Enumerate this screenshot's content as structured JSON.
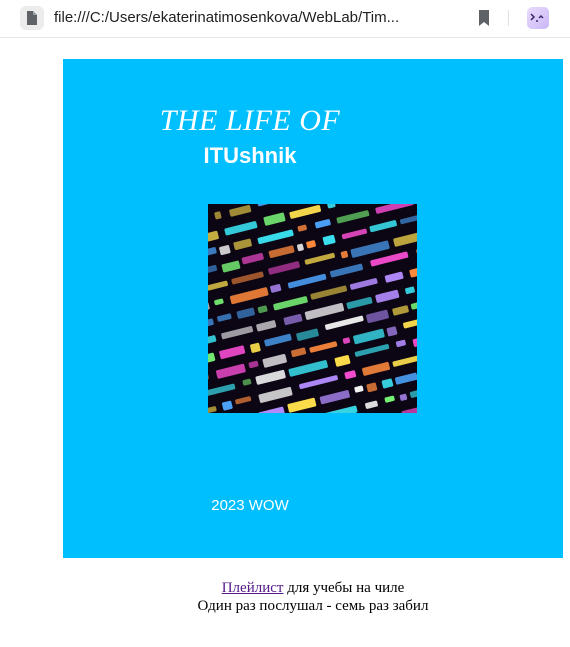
{
  "browser": {
    "url": "file:///C:/Users/ekaterinatimosenkova/WebLab/Tim...",
    "icons": [
      "page-icon",
      "bookmark-icon",
      "extension-icon"
    ]
  },
  "card": {
    "background": "#00bfff",
    "title": "THE LIFE OF",
    "subtitle": "ITUshnik",
    "image": "code-screen-image",
    "year": "2023 WOW"
  },
  "footer": {
    "link_text": "Плейлист",
    "line1_rest": " для учебы на чиле",
    "line2": "Один раз послушал - семь раз забил",
    "link_color": "#551a8b"
  }
}
